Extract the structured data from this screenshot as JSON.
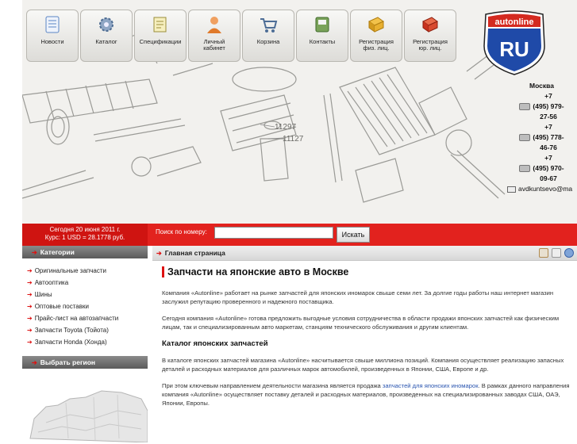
{
  "nav": [
    {
      "id": "news",
      "label": "Новости",
      "icon": "news-icon",
      "color": "#5b86c4"
    },
    {
      "id": "catalog",
      "label": "Каталог",
      "icon": "gear-icon",
      "color": "#6c86a8"
    },
    {
      "id": "specs",
      "label": "Спецификации",
      "icon": "document-icon",
      "color": "#b8ae5a"
    },
    {
      "id": "cabinet",
      "label": "Личный\nкабинет",
      "icon": "user-icon",
      "color": "#e07a2a"
    },
    {
      "id": "cart",
      "label": "Корзина",
      "icon": "cart-icon",
      "color": "#5f7fa8"
    },
    {
      "id": "contacts",
      "label": "Контакты",
      "icon": "address-book-icon",
      "color": "#5a8a3a"
    },
    {
      "id": "reg-phys",
      "label": "Регистрация\nфиз. лиц.",
      "icon": "book-icon",
      "color": "#d29a1e"
    },
    {
      "id": "reg-jur",
      "label": "Регистрация\nюр. лиц.",
      "icon": "book-red-icon",
      "color": "#c8321e"
    }
  ],
  "logo": {
    "top": "autonline",
    "bottom": "RU"
  },
  "contacts": {
    "city": "Москва",
    "phones": [
      "+7\n(495) 979-\n27-56",
      "+7\n(495) 778-\n46-76",
      "+7\n(495) 970-\n09-67"
    ],
    "email": "avdkuntsevo@ma"
  },
  "diagram_labels": [
    "11297",
    "11127"
  ],
  "redbar": {
    "date": "Сегодня 20 июня 2011 г.",
    "rate": "Курс: 1 USD = 28.1778 руб.",
    "search_label": "Поиск по номеру:",
    "search_value": "",
    "search_button": "Искать"
  },
  "sidebar": {
    "categories_title": "Категории",
    "items": [
      "Оригинальные запчасти",
      "Автооптика",
      "Шины",
      "Оптовые поставки",
      "Прайс-лист на автозапчасти",
      "Запчасти Toyota (Тойота)",
      "Запчасти Honda (Хонда)"
    ],
    "region_title": "Выбрать регион"
  },
  "main": {
    "crumb": "Главная страница",
    "title": "Запчасти на японские авто в Москве",
    "p1": "Компания «Autonline» работает на рынке запчастей для японских иномарок свыше семи лет. За долгие годы работы наш интернет магазин заслужил репутацию проверенного и надежного поставщика.",
    "p2": "Сегодня компания «Autonline» готова предложить выгодные условия сотрудничества в области продажи японских запчастей как физическим лицам, так и специализированным авто маркетам, станциям технического обслуживания и другим клиентам.",
    "h2": "Каталог японских запчастей",
    "p3": "В каталоге японских запчастей магазина «Autonline» насчитывается свыше миллиона позиций. Компания осуществляет реализацию запасных деталей и расходных материалов для различных марок автомобилей, произведенных в Японии, США, Европе и др.",
    "p4_before": "При этом ключевым направлением деятельности магазина является продажа ",
    "p4_link": "запчастей для японских иномарок",
    "p4_after": ". В рамках данного направления компания «Autonline» осуществляет поставку деталей и расходных материалов, произведенных на специализированных заводах США, ОАЭ, Японии, Европы."
  },
  "colors": {
    "red": "#e2221e",
    "dark_red": "#cf1411",
    "link": "#2a55b0",
    "logo_blue": "#1f4aa8"
  }
}
